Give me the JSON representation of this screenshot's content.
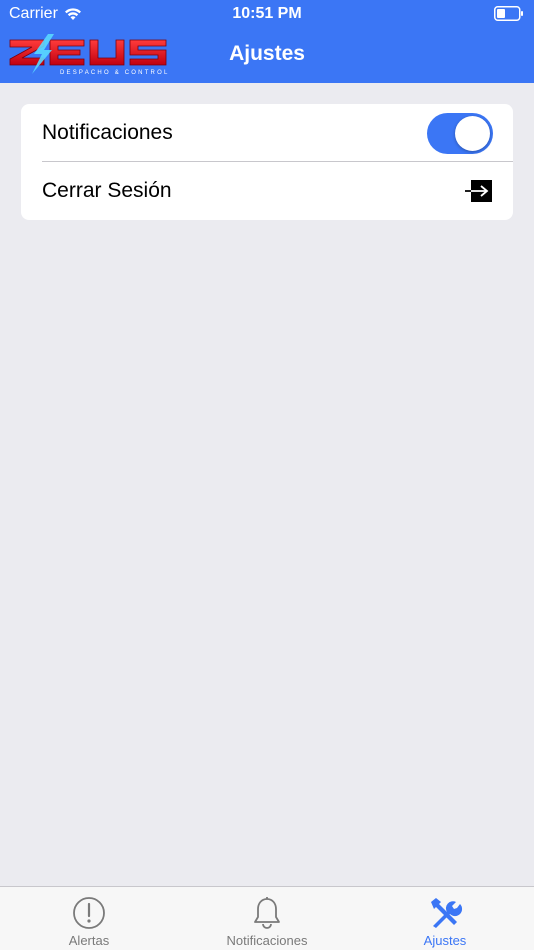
{
  "status_bar": {
    "carrier": "Carrier",
    "time": "10:51 PM"
  },
  "nav": {
    "title": "Ajustes",
    "logo_text": "ZEUS",
    "logo_subtitle": "DESPACHO & CONTROL"
  },
  "settings": {
    "rows": [
      {
        "label": "Notificaciones",
        "control": "toggle",
        "toggle_on": true
      },
      {
        "label": "Cerrar Sesión",
        "control": "logout-icon"
      }
    ]
  },
  "tabbar": {
    "tabs": [
      {
        "label": "Alertas",
        "icon": "exclamation-circle-icon",
        "active": false
      },
      {
        "label": "Notificaciones",
        "icon": "bell-icon",
        "active": false
      },
      {
        "label": "Ajustes",
        "icon": "tools-icon",
        "active": true
      }
    ]
  },
  "colors": {
    "primary": "#3b76f5",
    "background": "#ebebf0",
    "card": "#ffffff",
    "inactive_tab": "#7a7a7a"
  }
}
